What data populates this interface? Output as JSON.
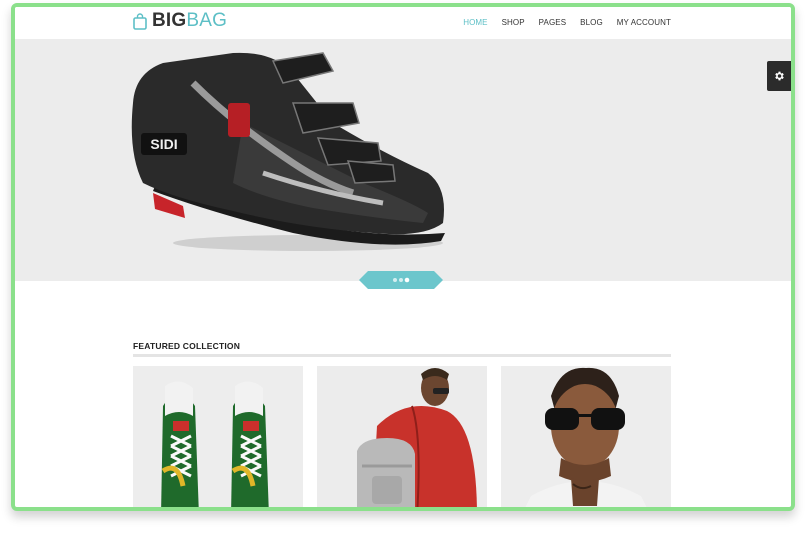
{
  "brand": {
    "part1": "BIG",
    "part2": "BAG"
  },
  "nav": {
    "items": [
      "HOME",
      "SHOP",
      "PAGES",
      "BLOG",
      "MY ACCOUNT"
    ],
    "active": "HOME"
  },
  "hero": {
    "product_brand": "SIDI",
    "slides_total": 3,
    "active_slide": 3
  },
  "featured": {
    "title": "FEATURED COLLECTION"
  },
  "colors": {
    "accent": "#5dbfc6",
    "frame": "#8be08b",
    "hero_bg": "#ececec"
  },
  "icons": {
    "settings": "gear-icon",
    "logo": "shopping-bag-icon"
  }
}
